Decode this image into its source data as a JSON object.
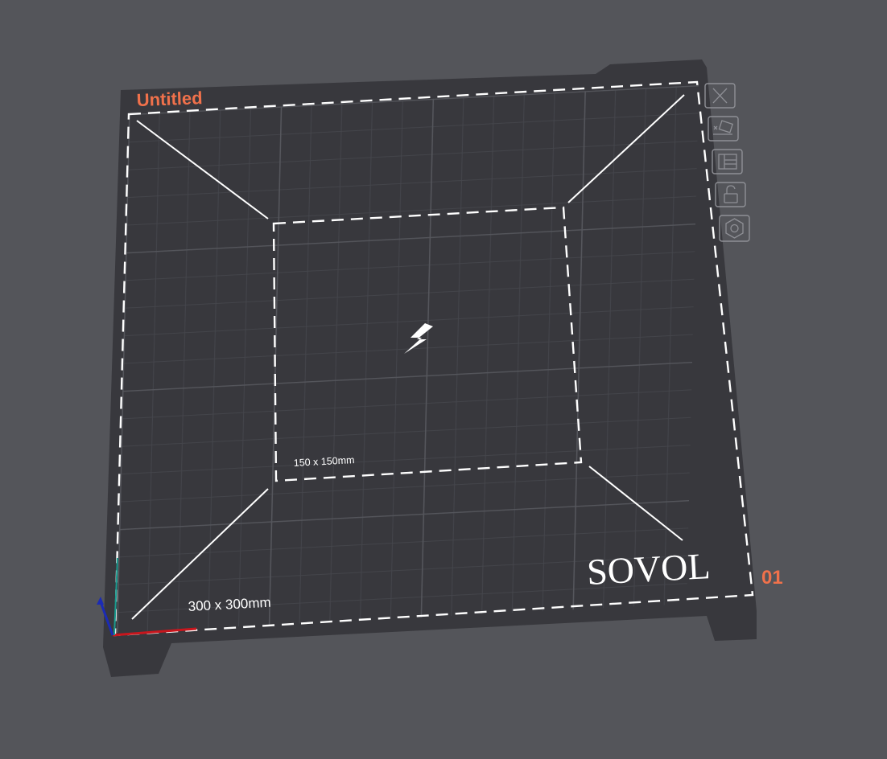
{
  "plate": {
    "name": "Untitled",
    "number": "01",
    "brand": "SOVOL",
    "bed_size_label": "300 x 300mm",
    "inner_size_label": "150 x 150mm"
  },
  "toolbar": {
    "close_icon": "close-icon",
    "auto_arrange_icon": "auto-arrange-icon",
    "layout_icon": "plate-layout-icon",
    "lock_icon": "unlock-icon",
    "settings_icon": "hexagon-settings-icon"
  },
  "colors": {
    "background": "#54555a",
    "plate": "#38383d",
    "grid": "#4b4c52",
    "accent": "#f0714b",
    "outline": "#ffffff",
    "icon": "#8f9096"
  },
  "center_icon": "lightning-bolt-icon",
  "axes": {
    "x_color": "#c8161d",
    "y_color": "#1a9a8e",
    "z_color": "#1b2bb5"
  }
}
